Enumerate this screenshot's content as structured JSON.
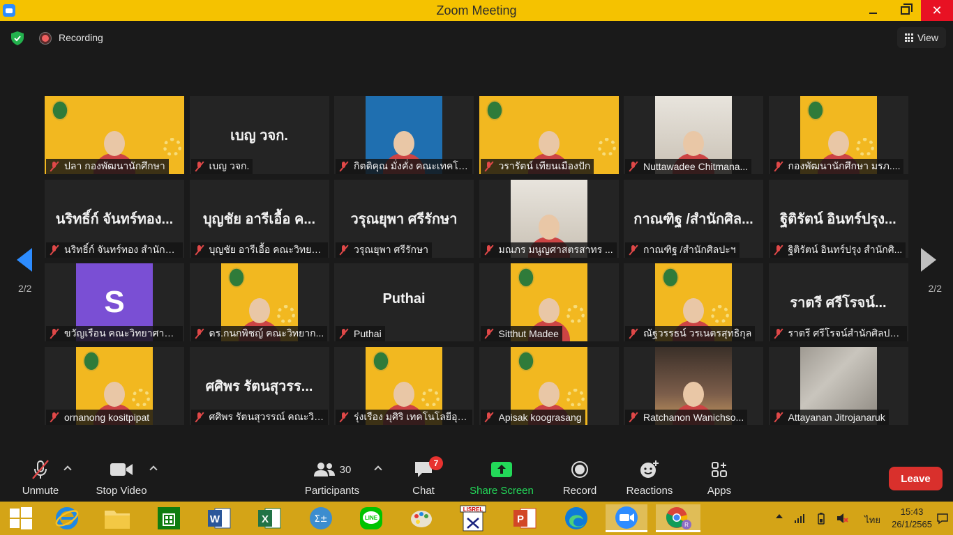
{
  "window": {
    "title": "Zoom Meeting"
  },
  "topbar": {
    "recording_label": "Recording",
    "view_label": "View"
  },
  "pagination": {
    "left": "2/2",
    "right": "2/2"
  },
  "tiles": [
    {
      "name": "ปลา กองพัฒนานักศึกษา",
      "kind": "video",
      "bg": "yellow"
    },
    {
      "name": "เบญ วจก.",
      "kind": "name",
      "display": "เบญ วจก."
    },
    {
      "name": "กิตติคุณ มั่งคั่ง คณะเทคโนโล...",
      "kind": "video",
      "bg": "blue"
    },
    {
      "name": "วรารัตน์ เทียนเมืองปัก",
      "kind": "video",
      "bg": "yellow"
    },
    {
      "name": "Nuttawadee Chitmana...",
      "kind": "video",
      "bg": "room"
    },
    {
      "name": "กองพัฒนานักศึกษา มรภ....",
      "kind": "video",
      "bg": "yellow"
    },
    {
      "name": "นริทธิ์ก์ จันทร์ทอง สำนักศิ...",
      "kind": "name",
      "display": "นริทธิ์ก์ จันทร์ทอง..."
    },
    {
      "name": "บุญชัย อารีเอื้อ คณะวิทยาศ...",
      "kind": "name",
      "display": "บุญชัย อารีเอื้อ ค..."
    },
    {
      "name": "วรุณยุพา ศรีรักษา",
      "kind": "name",
      "display": "วรุณยุพา ศรีรักษา"
    },
    {
      "name": "มณภร มนูญศาสตรสาทร ...",
      "kind": "video",
      "bg": "room"
    },
    {
      "name": "กาณฑิฐ /สำนักศิลปะฯ",
      "kind": "name",
      "display": "กาณฑิฐ /สำนักศิล..."
    },
    {
      "name": "ฐิติรัตน์ อินทร์ปรุง สำนักศิ...",
      "kind": "name",
      "display": "ฐิติรัตน์ อินทร์ปรุง..."
    },
    {
      "name": "ขวัญเรือน คณะวิทยาศาสต...",
      "kind": "avatar",
      "letter": "S"
    },
    {
      "name": "ดร.กนกพิชญ์ คณะวิทยาก...",
      "kind": "video",
      "bg": "yellow"
    },
    {
      "name": "Puthai",
      "kind": "name",
      "display": "Puthai"
    },
    {
      "name": "Sitthut Madee",
      "kind": "video",
      "bg": "yellow"
    },
    {
      "name": "ณัฐวรรธน์ วรเนตรสุทธิกุล",
      "kind": "video",
      "bg": "yellow"
    },
    {
      "name": "ราตรี ศรีโรจน์สำนักศิลปะ...",
      "kind": "name",
      "display": "ราตรี ศรีโรจน์..."
    },
    {
      "name": "ornanong kositpipat",
      "kind": "video",
      "bg": "yellow"
    },
    {
      "name": "ศศิพร รัตนสุวรรณ์ คณะวิท...",
      "kind": "name",
      "display": "ศศิพร รัตนสุวรร..."
    },
    {
      "name": "รุ่งเรือง มุศิริ เทคโนโลยีอุตส...",
      "kind": "video",
      "bg": "yellow"
    },
    {
      "name": "Apisak koograsang",
      "kind": "video",
      "bg": "yellow"
    },
    {
      "name": "Ratchanon Wanichso...",
      "kind": "video",
      "bg": "restaurant"
    },
    {
      "name": "Attayanan Jitrojanaruk",
      "kind": "video",
      "bg": "gray"
    }
  ],
  "toolbar": {
    "unmute": "Unmute",
    "stop_video": "Stop Video",
    "participants": "Participants",
    "participants_count": "30",
    "chat": "Chat",
    "chat_badge": "7",
    "share_screen": "Share Screen",
    "record": "Record",
    "reactions": "Reactions",
    "apps": "Apps",
    "leave": "Leave"
  },
  "taskbar": {
    "language": "ไทย",
    "time": "15:43",
    "date": "26/1/2565"
  },
  "colors": {
    "title_bar": "#f5c200",
    "taskbar": "#d4a417",
    "accent_blue": "#2d8cff",
    "share_green": "#23d959",
    "leave_red": "#d9302c"
  }
}
